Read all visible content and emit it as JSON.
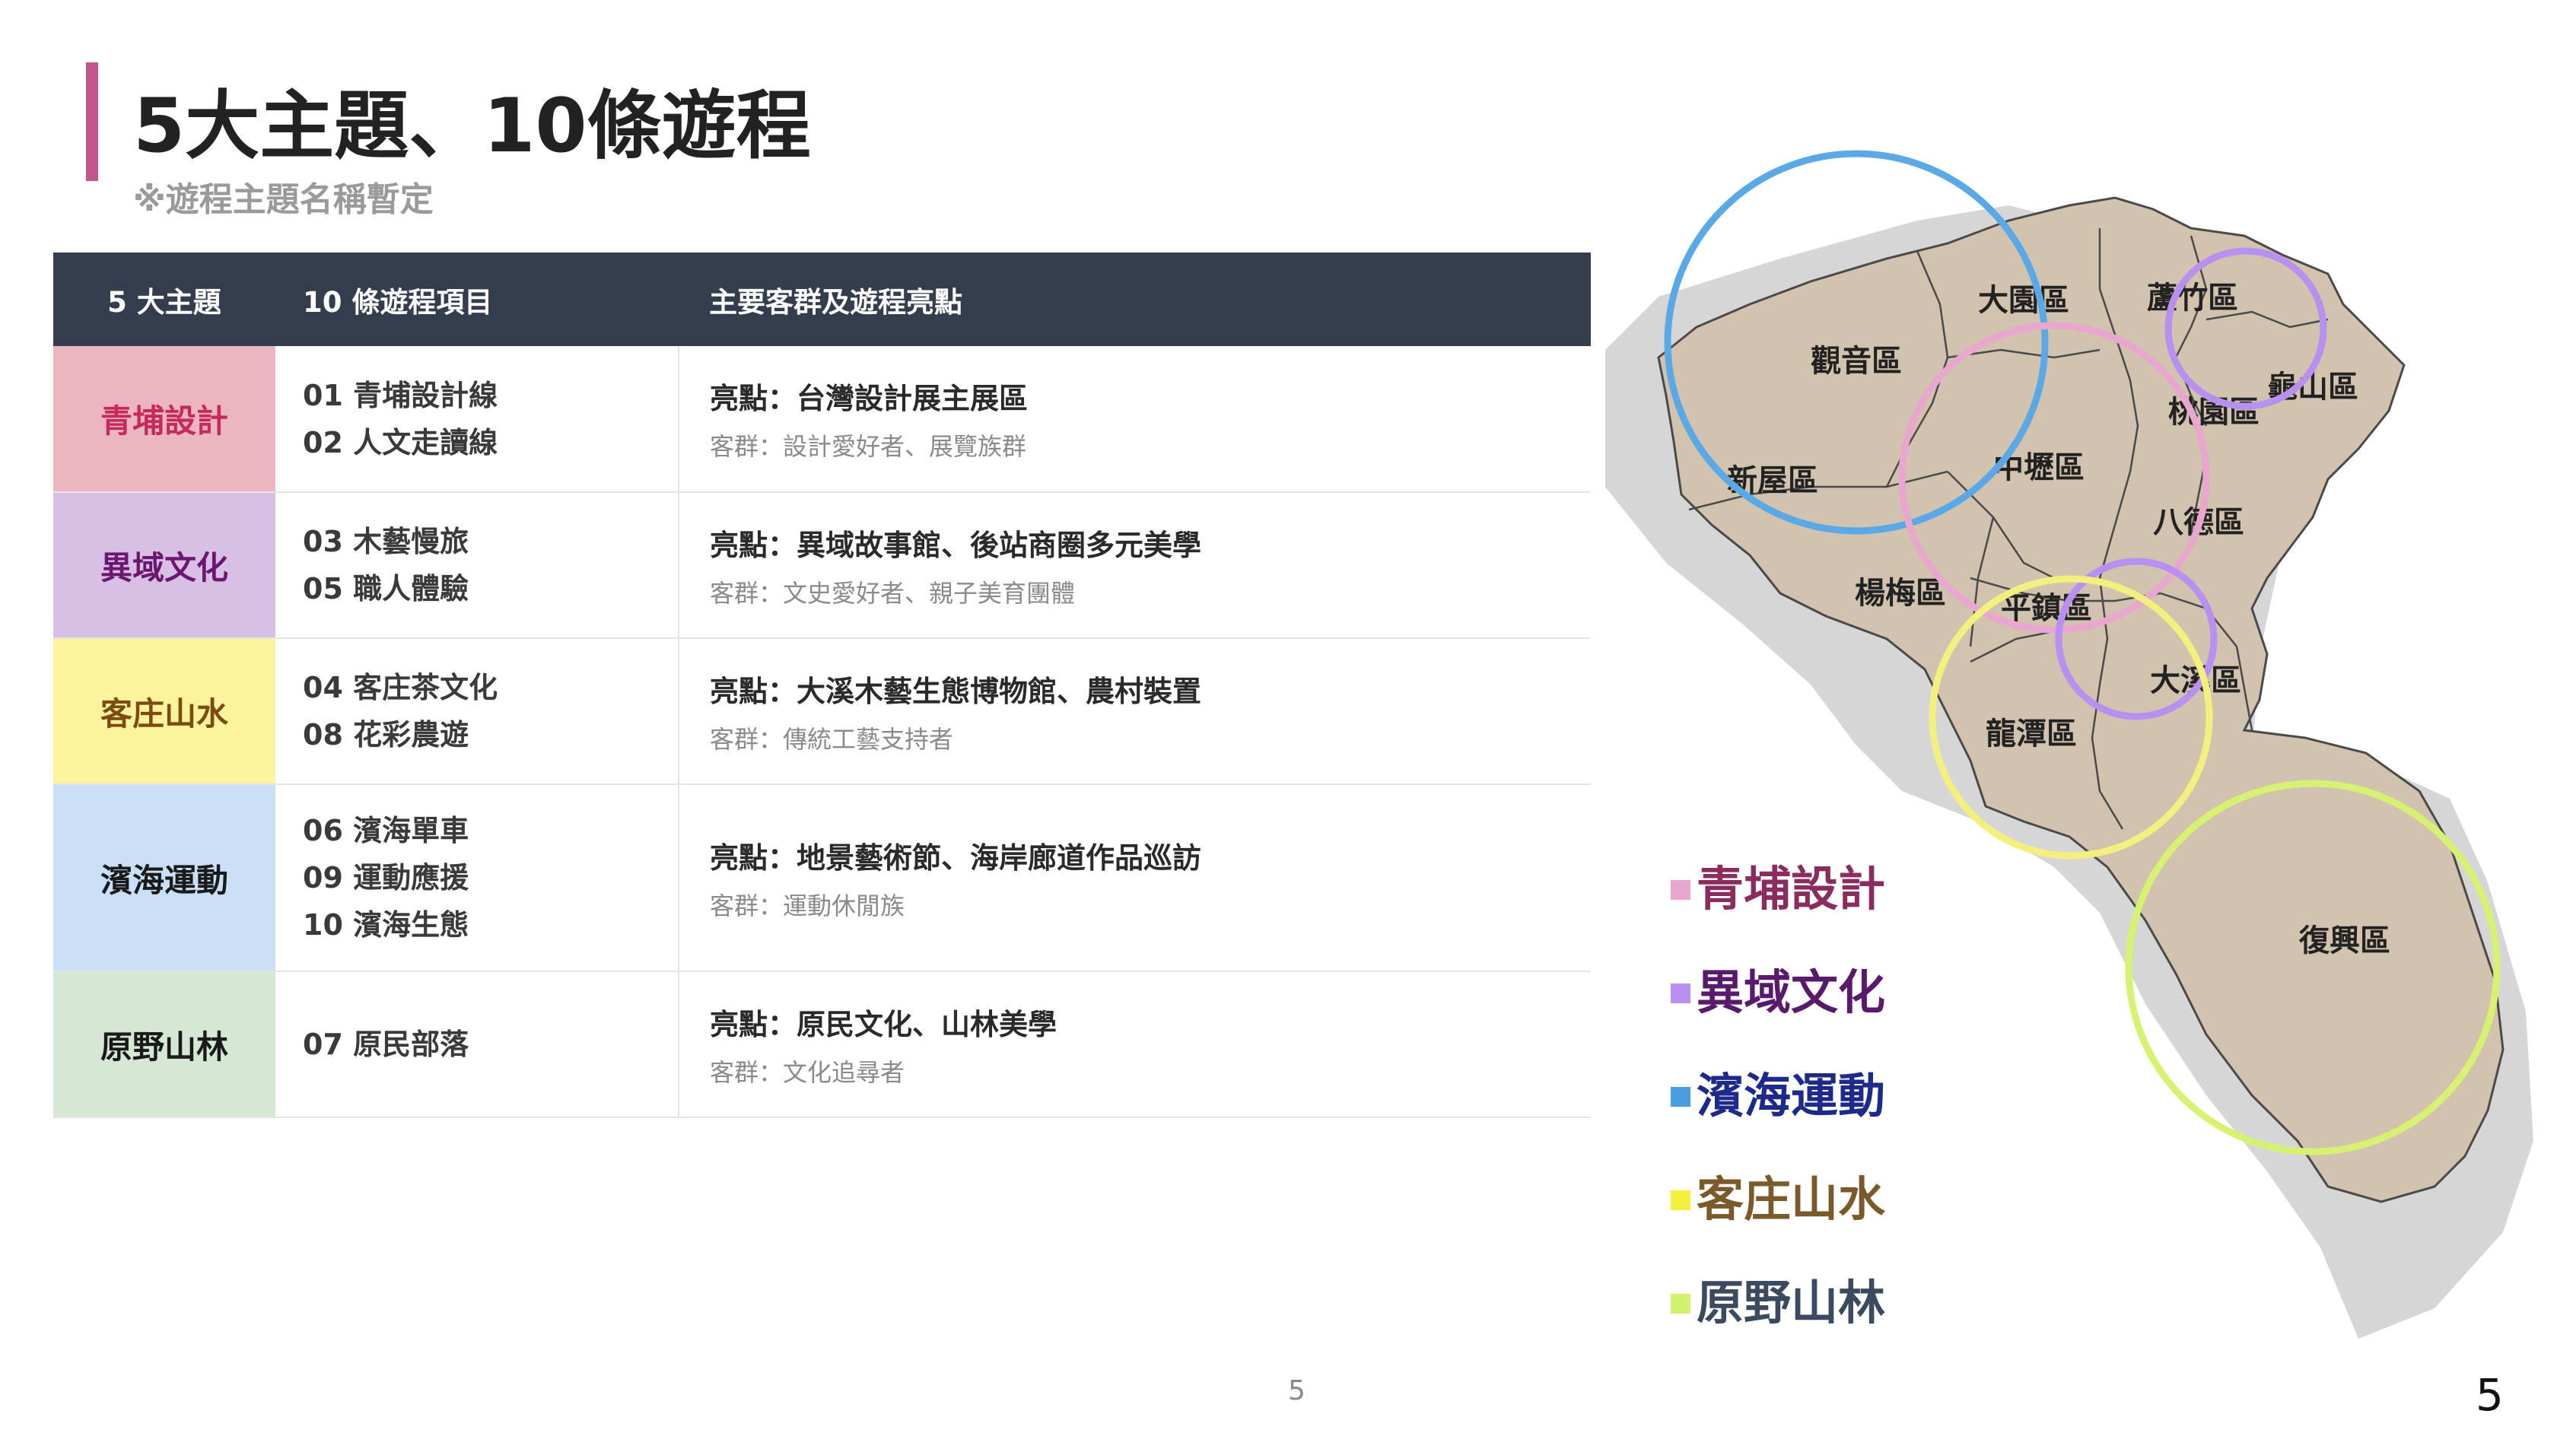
{
  "header": {
    "title": "5大主題、10條遊程",
    "subtitle": "※遊程主題名稱暫定"
  },
  "table": {
    "headers": [
      "5 大主題",
      "10 條遊程項目",
      "主要客群及遊程亮點"
    ],
    "rows": [
      {
        "theme": "青埔設計",
        "theme_color": "#c62a5c",
        "bg": "#ecb6c1",
        "items": [
          "01 青埔設計線",
          "02 人文走讀線"
        ],
        "highlight_label": "亮點：",
        "highlight": "台灣設計展主展區",
        "audience_label": "客群：",
        "audience": "設計愛好者、展覽族群"
      },
      {
        "theme": "異域文化",
        "theme_color": "#6b1670",
        "bg": "#d8bfe4",
        "items": [
          "03 木藝慢旅",
          "05 職人體驗"
        ],
        "highlight_label": "亮點：",
        "highlight": "異域故事館、後站商圈多元美學",
        "audience_label": "客群：",
        "audience": "文史愛好者、親子美育團體"
      },
      {
        "theme": "客庄山水",
        "theme_color": "#7c4a13",
        "bg": "#fbf49c",
        "items": [
          "04 客庄茶文化",
          "08 花彩農遊"
        ],
        "highlight_label": "亮點：",
        "highlight": "大溪木藝生態博物館、農村裝置",
        "audience_label": "客群：",
        "audience": "傳統工藝支持者"
      },
      {
        "theme": "濱海運動",
        "theme_color": "#1a1a1a",
        "bg": "#c9e0f7",
        "items": [
          "06 濱海單車",
          "09 運動應援",
          "10 濱海生態"
        ],
        "highlight_label": "亮點：",
        "highlight": "地景藝術節、海岸廊道作品巡訪",
        "audience_label": "客群：",
        "audience": "運動休閒族"
      },
      {
        "theme": "原野山林",
        "theme_color": "#1a1a1a",
        "bg": "#d5e8d3",
        "items": [
          "07 原民部落"
        ],
        "highlight_label": "亮點：",
        "highlight": "原民文化、山林美學",
        "audience_label": "客群：",
        "audience": "文化追尋者"
      }
    ]
  },
  "map": {
    "districts": [
      "大園區",
      "蘆竹區",
      "觀音區",
      "龜山區",
      "桃園區",
      "新屋區",
      "中壢區",
      "八德區",
      "楊梅區",
      "平鎮區",
      "大溪區",
      "龍潭區",
      "復興區"
    ],
    "circle_colors": {
      "blue": "#5aa9e6",
      "pink": "#e9a6cf",
      "purple": "#b890ef",
      "yellow": "#f3f07f",
      "green": "#d7f273"
    }
  },
  "legend": [
    {
      "label": "青埔設計",
      "square": "#e9a6cf",
      "text_color": "#8a2d5e"
    },
    {
      "label": "異域文化",
      "square": "#b890ef",
      "text_color": "#5a1a6c"
    },
    {
      "label": "濱海運動",
      "square": "#4c9de0",
      "text_color": "#1e2a8a"
    },
    {
      "label": "客庄山水",
      "square": "#f5f040",
      "text_color": "#7a5a2a"
    },
    {
      "label": "原野山林",
      "square": "#d2f26e",
      "text_color": "#3b4a5e"
    }
  ],
  "page": {
    "center_number": "5",
    "right_number": "5"
  }
}
